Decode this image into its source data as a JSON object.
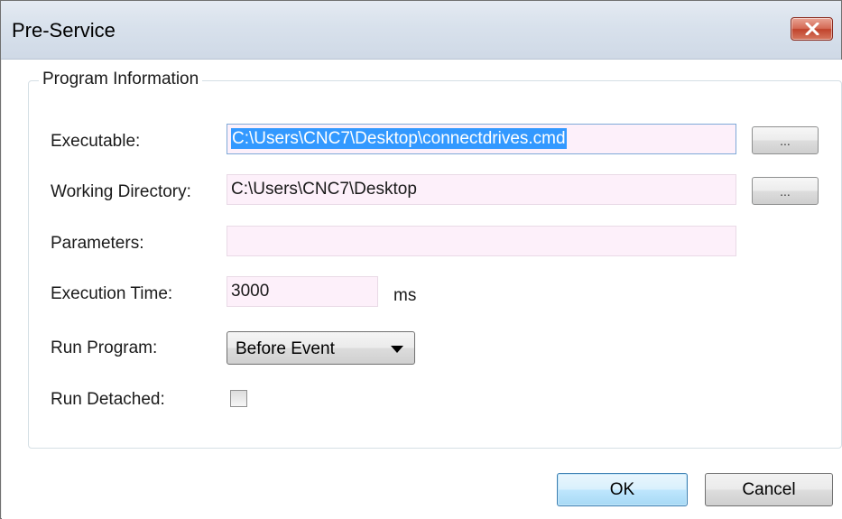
{
  "window": {
    "title": "Pre-Service",
    "close_icon": "close-x-icon"
  },
  "group": {
    "title": "Program Information"
  },
  "form": {
    "executable": {
      "label": "Executable:",
      "value": "C:\\Users\\CNC7\\Desktop\\connectdrives.cmd",
      "browse_label": "..."
    },
    "working_directory": {
      "label": "Working Directory:",
      "value": "C:\\Users\\CNC7\\Desktop",
      "browse_label": "..."
    },
    "parameters": {
      "label": "Parameters:",
      "value": ""
    },
    "execution_time": {
      "label": "Execution Time:",
      "value": "3000",
      "unit": "ms"
    },
    "run_program": {
      "label": "Run Program:",
      "selected": "Before Event"
    },
    "run_detached": {
      "label": "Run Detached:",
      "checked": false
    }
  },
  "buttons": {
    "ok_label": "OK",
    "cancel_label": "Cancel"
  },
  "colors": {
    "field_background": "#fdf0fa",
    "selection": "#3399ff",
    "close_button": "#c7432c"
  }
}
